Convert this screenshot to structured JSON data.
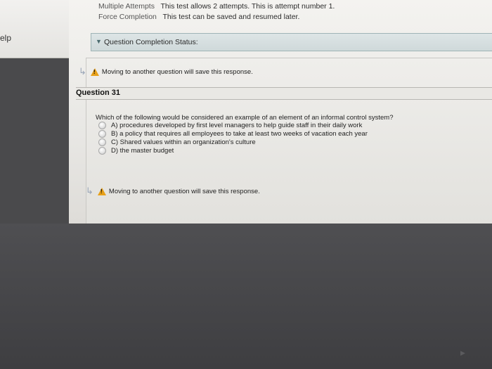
{
  "sidebar": {
    "label": "elp"
  },
  "attempts": {
    "multiple_label": "Multiple Attempts",
    "multiple_value": "This test allows 2 attempts. This is attempt number 1.",
    "force_label": "Force Completion",
    "force_value": "This test can be saved and resumed later."
  },
  "status": {
    "label": "Question Completion Status:"
  },
  "warning": {
    "text": "Moving to another question will save this response."
  },
  "question": {
    "title": "Question 31",
    "text": "Which of the following would be considered an example of an element of an informal control system?",
    "options": [
      "A) procedures developed by first level managers to help guide staff in their daily work",
      "B) a policy that requires all employees to take at least two weeks of vacation each year",
      "C) Shared values within an organization's culture",
      "D) the master budget"
    ]
  },
  "icons": {
    "chevron": "chevron-down-icon",
    "warning": "warning-icon",
    "arrow": "return-arrow-icon"
  },
  "colors": {
    "warning": "#e7a019",
    "status_bar": "#cfd9da"
  }
}
